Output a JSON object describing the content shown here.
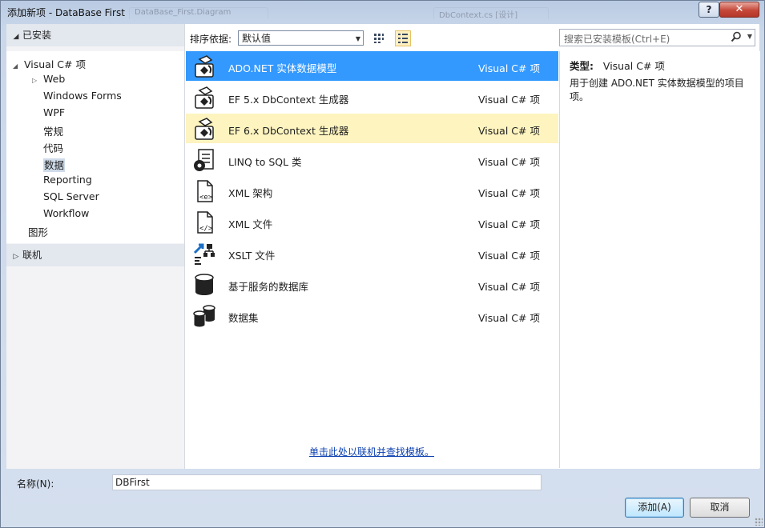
{
  "window": {
    "title": "添加新项 - DataBase First",
    "background_ghost_tabs": [
      "DataBase_First.Diagram",
      "DbContext.cs [设计]"
    ],
    "help_label": "?",
    "close_label": "✕"
  },
  "left": {
    "installed_header": "已安装",
    "tree": [
      {
        "label": "Visual C# 项",
        "expanded": true
      },
      {
        "label": "Web",
        "collapsed_arrow": true
      },
      {
        "label": "Windows Forms"
      },
      {
        "label": "WPF"
      },
      {
        "label": "常规"
      },
      {
        "label": "代码"
      },
      {
        "label": "数据",
        "selected": true
      },
      {
        "label": "Reporting"
      },
      {
        "label": "SQL Server"
      },
      {
        "label": "Workflow"
      },
      {
        "label": "图形"
      }
    ],
    "online_header": "联机"
  },
  "toolbar": {
    "sort_label": "排序依据:",
    "sort_value": "默认值"
  },
  "templates": [
    {
      "name": "ADO.NET 实体数据模型",
      "lang": "Visual C# 项",
      "icon": "entity-model-icon",
      "state": "selected"
    },
    {
      "name": "EF 5.x DbContext 生成器",
      "lang": "Visual C# 项",
      "icon": "dbcontext-generator-icon"
    },
    {
      "name": "EF 6.x DbContext 生成器",
      "lang": "Visual C# 项",
      "icon": "dbcontext-generator-icon",
      "state": "hover"
    },
    {
      "name": "LINQ to SQL 类",
      "lang": "Visual C# 项",
      "icon": "linq-to-sql-icon"
    },
    {
      "name": "XML 架构",
      "lang": "Visual C# 项",
      "icon": "xml-schema-icon"
    },
    {
      "name": "XML 文件",
      "lang": "Visual C# 项",
      "icon": "xml-file-icon"
    },
    {
      "name": "XSLT 文件",
      "lang": "Visual C# 项",
      "icon": "xslt-file-icon"
    },
    {
      "name": "基于服务的数据库",
      "lang": "Visual C# 项",
      "icon": "database-icon"
    },
    {
      "name": "数据集",
      "lang": "Visual C# 项",
      "icon": "dataset-icon"
    }
  ],
  "online_link": "单击此处以联机并查找模板。",
  "search": {
    "placeholder": "搜索已安装模板(Ctrl+E)"
  },
  "description": {
    "type_label": "类型:",
    "type_value": "Visual C# 项",
    "text": "用于创建 ADO.NET 实体数据模型的项目项。"
  },
  "bottom": {
    "name_label": "名称(N):",
    "name_value": "DBFirst",
    "add_button": "添加(A)",
    "cancel_button": "取消"
  },
  "colors": {
    "selection": "#3399ff",
    "hover": "#fdf4bf",
    "link": "#0b3fb0"
  }
}
